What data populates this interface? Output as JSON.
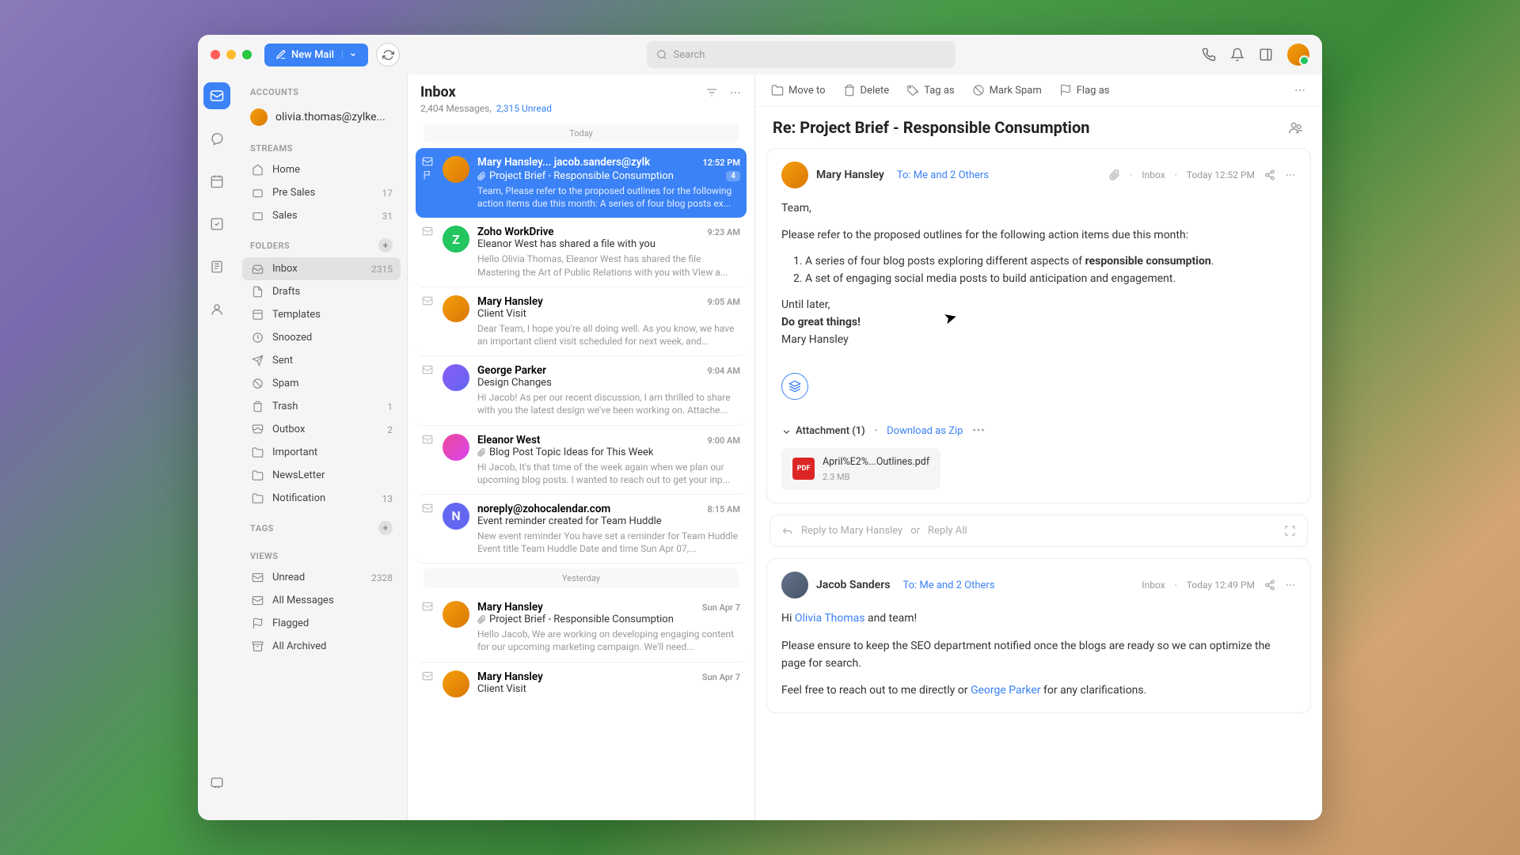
{
  "titlebar": {
    "new_mail": "New Mail",
    "search_placeholder": "Search"
  },
  "sidebar": {
    "accounts_title": "ACCOUNTS",
    "account_email": "olivia.thomas@zylke...",
    "streams_title": "STREAMS",
    "streams": [
      {
        "label": "Home",
        "count": ""
      },
      {
        "label": "Pre Sales",
        "count": "17"
      },
      {
        "label": "Sales",
        "count": "31"
      }
    ],
    "folders_title": "FOLDERS",
    "folders": [
      {
        "label": "Inbox",
        "count": "2315"
      },
      {
        "label": "Drafts",
        "count": ""
      },
      {
        "label": "Templates",
        "count": ""
      },
      {
        "label": "Snoozed",
        "count": ""
      },
      {
        "label": "Sent",
        "count": ""
      },
      {
        "label": "Spam",
        "count": ""
      },
      {
        "label": "Trash",
        "count": "1"
      },
      {
        "label": "Outbox",
        "count": "2"
      },
      {
        "label": "Important",
        "count": ""
      },
      {
        "label": "NewsLetter",
        "count": ""
      },
      {
        "label": "Notification",
        "count": "13"
      }
    ],
    "tags_title": "TAGS",
    "views_title": "VIEWS",
    "views": [
      {
        "label": "Unread",
        "count": "2328"
      },
      {
        "label": "All Messages",
        "count": ""
      },
      {
        "label": "Flagged",
        "count": ""
      },
      {
        "label": "All Archived",
        "count": ""
      }
    ]
  },
  "message_list": {
    "title": "Inbox",
    "count_text": "2,404 Messages,",
    "unread_text": "2,315 Unread",
    "today": "Today",
    "yesterday": "Yesterday",
    "messages": [
      {
        "sender": "Mary Hansley... jacob.sanders@zylk",
        "time": "12:52 PM",
        "subject": "Project Brief - Responsible Consumption",
        "badge": "4",
        "preview": "Team, Please refer to the proposed outlines for the following action items due this month: A series of four blog posts ex...",
        "attach": true
      },
      {
        "sender": "Zoho WorkDrive",
        "time": "9:23 AM",
        "subject": "Eleanor West has shared a file with you",
        "preview": "Hello Olivia Thomas, Eleanor West has shared the file Mastering the Art of Public Relations with you with View a..."
      },
      {
        "sender": "Mary Hansley",
        "time": "9:05 AM",
        "subject": "Client Visit",
        "preview": "Dear Team, I hope you're all doing well. As you know, we have an important client visit scheduled for next week, and..."
      },
      {
        "sender": "George Parker",
        "time": "9:04 AM",
        "subject": "Design Changes",
        "preview": "Hi Jacob! As per our recent discussion, I am thrilled to share with you the latest design we've been working on. Attache..."
      },
      {
        "sender": "Eleanor West",
        "time": "9:00 AM",
        "subject": "Blog Post Topic Ideas for This Week",
        "preview": "Hi Jacob, It's that time of the week again when we plan our upcoming blog posts. I wanted to reach out to get your inp...",
        "attach": true
      },
      {
        "sender": "noreply@zohocalendar.com",
        "time": "8:15 AM",
        "subject": "Event reminder created for Team Huddle",
        "preview": "New event reminder You have set a reminder for Team Huddle Event title Team Huddle Date and time Sun Apr 07,..."
      }
    ],
    "yesterday_messages": [
      {
        "sender": "Mary Hansley",
        "time": "Sun Apr 7",
        "subject": "Project Brief - Responsible Consumption",
        "preview": "Hello Jacob, We are working on developing engaging content for our upcoming marketing campaign. We'll need...",
        "attach": true
      },
      {
        "sender": "Mary Hansley",
        "time": "Sun Apr 7",
        "subject": "Client Visit",
        "preview": ""
      }
    ]
  },
  "reading": {
    "toolbar": {
      "move": "Move to",
      "delete": "Delete",
      "tag": "Tag as",
      "spam": "Mark Spam",
      "flag": "Flag as"
    },
    "subject": "Re: Project Brief - Responsible Consumption",
    "msg1": {
      "sender": "Mary Hansley",
      "to": "To: Me and 2 Others",
      "folder": "Inbox",
      "time": "Today 12:52 PM",
      "greeting": "Team,",
      "intro": "Please refer to the proposed outlines for the following action items due this month:",
      "li1a": "A series of four blog posts exploring different aspects of ",
      "li1b": "responsible consumption",
      "li1c": ".",
      "li2": "A set of engaging social media posts to build anticipation and engagement.",
      "closing1": "Until later,",
      "closing2": "Do great things!",
      "closing3": "Mary Hansley",
      "attach_label": "Attachment (1)",
      "download": "Download as Zip",
      "file_name": "April%E2%...Outlines.pdf",
      "file_size": "2.3 MB"
    },
    "reply": {
      "placeholder": "Reply to Mary Hansley",
      "or": "or",
      "reply_all": "Reply All"
    },
    "msg2": {
      "sender": "Jacob Sanders",
      "to": "To: Me and 2 Others",
      "folder": "Inbox",
      "time": "Today 12:49 PM",
      "line1a": "Hi ",
      "line1_mention": "Olivia Thomas",
      "line1b": " and team!",
      "line2": "Please ensure to keep the SEO department notified once the blogs are ready so we can optimize the page for search.",
      "line3a": "Feel free to reach out to me directly or ",
      "line3_mention": "George Parker",
      "line3b": " for any clarifications."
    }
  }
}
